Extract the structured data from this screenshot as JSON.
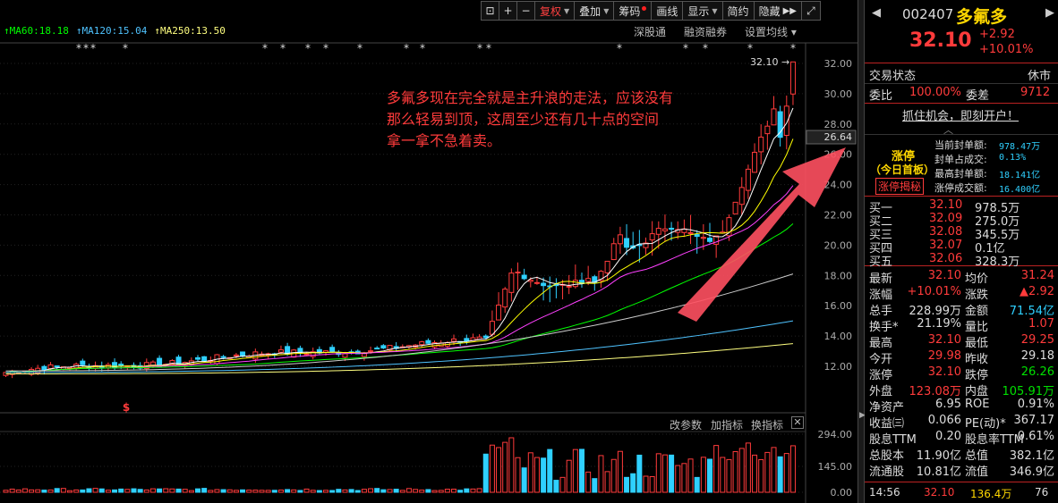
{
  "toolbar": {
    "buttons": [
      "复权",
      "叠加",
      "筹码",
      "画线",
      "显示",
      "简约",
      "隐藏"
    ],
    "fuquan": "复权",
    "diejia": "叠加",
    "chouma": "筹码",
    "huaxian": "画线",
    "xianshi": "显示",
    "jianyue": "简约",
    "yincang": "隐藏"
  },
  "ma_labels": {
    "ma60": "MA60:18.18",
    "ma120": "MA120:15.04",
    "ma250": "MA250:13.50"
  },
  "sub_links": {
    "shengutong": "深股通",
    "rongzi": "融资融券",
    "shezhi": "设置均线"
  },
  "price_label": "32.10",
  "crosshair_label": "26.64",
  "y_axis": [
    "32.00",
    "30.00",
    "28.00",
    "26.00",
    "24.00",
    "22.00",
    "20.00",
    "18.00",
    "16.00",
    "14.00",
    "12.00"
  ],
  "overlay_text": [
    "多氟多现在完全就是主升浪的走法，应该没有",
    "那么轻易到顶，这周至少还有几十点的空间",
    "拿一拿不急着卖。"
  ],
  "lower_links": {
    "gaicanshu": "改参数",
    "jiazhibiao": "加指标",
    "huanzhibiao": "换指标"
  },
  "vol_axis": [
    "294.00",
    "145.00",
    "0.00"
  ],
  "dividend_marker": "$",
  "colors": {
    "up": "#ff3b3b",
    "down": "#2fd0ff",
    "ma5": "#ffffff",
    "ma10": "#ffff00",
    "ma20": "#ff40ff",
    "ma60": "#00ff00",
    "ma120": "#4fc3ff",
    "ma250": "#ffff80"
  },
  "panel": {
    "code": "002407",
    "name": "多氟多",
    "price": "32.10",
    "change": "+2.92",
    "change_pct": "+10.01%",
    "trade_status_label": "交易状态",
    "trade_status": "休市",
    "weibi_label": "委比",
    "weibi": "100.00%",
    "weicha_label": "委差",
    "weicha": "9712",
    "promo": "抓住机会，即刻开户！",
    "zt_title": "涨停",
    "zt_sub": "（今日首板）",
    "zt_btn": "涨停揭秘",
    "zt_info": [
      {
        "k": "当前封单额:",
        "v": "978.47万"
      },
      {
        "k": "封单占成交:",
        "v": "0.13%"
      },
      {
        "k": "最高封单额:",
        "v": "18.141亿"
      },
      {
        "k": "涨停成交额:",
        "v": "16.400亿"
      }
    ],
    "bids": [
      {
        "label": "买一",
        "price": "32.10",
        "vol": "978.5万"
      },
      {
        "label": "买二",
        "price": "32.09",
        "vol": "275.0万"
      },
      {
        "label": "买三",
        "price": "32.08",
        "vol": "345.5万"
      },
      {
        "label": "买四",
        "price": "32.07",
        "vol": "0.1亿"
      },
      {
        "label": "买五",
        "price": "32.06",
        "vol": "328.3万"
      }
    ],
    "stats": [
      {
        "k1": "最新",
        "v1": "32.10",
        "c1": "red",
        "k2": "均价",
        "v2": "31.24",
        "c2": "red"
      },
      {
        "k1": "涨幅",
        "v1": "+10.01%",
        "c1": "red",
        "k2": "涨跌",
        "v2": "▲2.92",
        "c2": "red"
      },
      {
        "k1": "总手",
        "v1": "228.99万",
        "c1": "white",
        "k2": "金额",
        "v2": "71.54亿",
        "c2": "cyan"
      },
      {
        "k1": "换手*",
        "v1": "21.19%",
        "c1": "white",
        "k2": "量比",
        "v2": "1.07",
        "c2": "red"
      },
      {
        "k1": "最高",
        "v1": "32.10",
        "c1": "red",
        "k2": "最低",
        "v2": "29.25",
        "c2": "red"
      },
      {
        "k1": "今开",
        "v1": "29.98",
        "c1": "red",
        "k2": "昨收",
        "v2": "29.18",
        "c2": "white"
      },
      {
        "k1": "涨停",
        "v1": "32.10",
        "c1": "red",
        "k2": "跌停",
        "v2": "26.26",
        "c2": "green"
      },
      {
        "k1": "外盘",
        "v1": "123.08万",
        "c1": "red",
        "k2": "内盘",
        "v2": "105.91万",
        "c2": "green"
      },
      {
        "k1": "净资产",
        "v1": "6.95",
        "c1": "white",
        "k2": "ROE",
        "v2": "0.91%",
        "c2": "white"
      },
      {
        "k1": "收益㈢",
        "v1": "0.066",
        "c1": "white",
        "k2": "PE(动)*",
        "v2": "367.17",
        "c2": "white"
      },
      {
        "k1": "股息TTM",
        "v1": "0.20",
        "c1": "white",
        "k2": "股息率TTM",
        "v2": "0.61%",
        "c2": "white"
      },
      {
        "k1": "总股本",
        "v1": "11.90亿",
        "c1": "white",
        "k2": "总值",
        "v2": "382.1亿",
        "c2": "white"
      },
      {
        "k1": "流通股",
        "v1": "10.81亿",
        "c1": "white",
        "k2": "流值",
        "v2": "346.9亿",
        "c2": "white"
      }
    ],
    "tick": {
      "time": "14:56",
      "price": "32.10",
      "vol": "136.4万",
      "num": "76"
    }
  }
}
